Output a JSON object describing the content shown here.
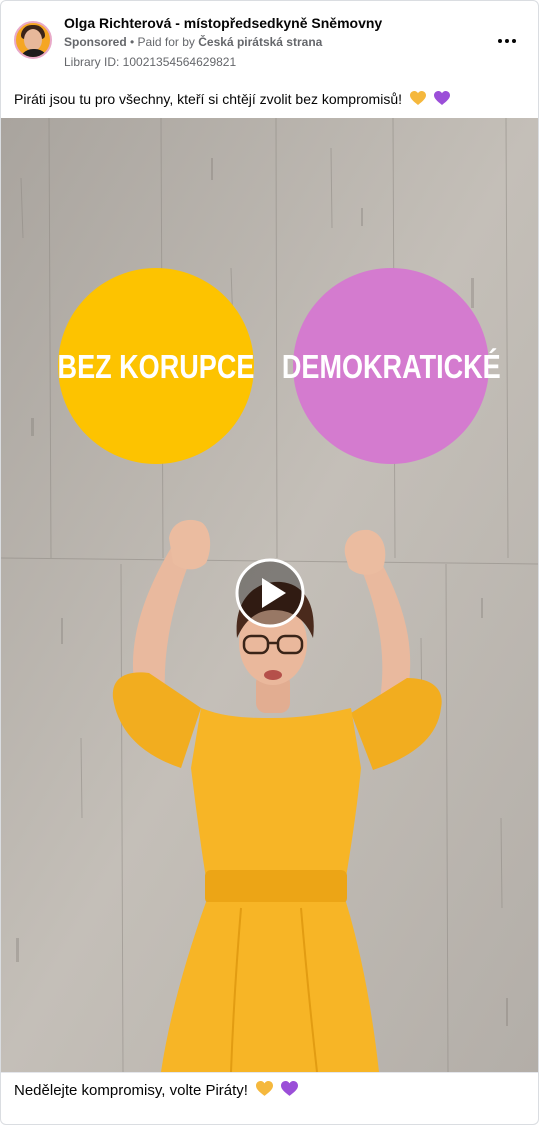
{
  "header": {
    "page_name": "Olga Richterová - místopředsedkyně Sněmovny",
    "sponsored_label": "Sponsored",
    "separator": " • ",
    "paid_for_prefix": "Paid for by ",
    "paid_for_name": "Česká pirátská strana",
    "library_id": "Library ID: 10021354564629821"
  },
  "post": {
    "text": "Piráti jsou tu pro všechny, kteří si chtějí zvolit bez kompromisů!"
  },
  "media": {
    "circle_left_text": "BEZ KORUPCE",
    "circle_right_text": "DEMOKRATICKÉ",
    "colors": {
      "circle_left": "#fdc300",
      "circle_right": "#d47bcf",
      "dress": "#f7b526",
      "wall": "#bdb8b2"
    }
  },
  "caption": {
    "text": "Nedělejte kompromisy, volte Piráty!"
  },
  "icons": {
    "heart_yellow": "yellow-heart-icon",
    "heart_purple": "purple-heart-icon",
    "play": "play-icon",
    "more": "more-options-icon"
  },
  "colors": {
    "heart_yellow": "#f5b83d",
    "heart_purple": "#9b4fd8",
    "secondary_text": "#65676b"
  }
}
